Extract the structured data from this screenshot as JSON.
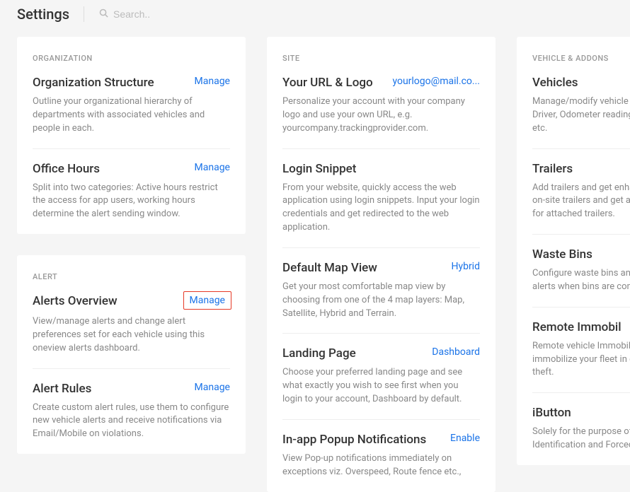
{
  "header": {
    "title": "Settings",
    "search_placeholder": "Search.."
  },
  "columns": [
    {
      "cards": [
        {
          "name": "organization-card",
          "header": "ORGANIZATION",
          "items": [
            {
              "name": "org-structure",
              "title": "Organization Structure",
              "action": "Manage",
              "desc": "Outline your organizational hierarchy of departments with associated vehicles and people in each."
            },
            {
              "name": "office-hours",
              "title": "Office Hours",
              "action": "Manage",
              "desc": "Split into two categories: Active hours restrict the access for app users, working hours determine the alert sending window."
            }
          ]
        },
        {
          "name": "alert-card",
          "header": "ALERT",
          "items": [
            {
              "name": "alerts-overview",
              "title": "Alerts Overview",
              "action": "Manage",
              "highlighted": true,
              "desc": "View/manage alerts and change alert preferences set for each vehicle using this oneview alerts dashboard."
            },
            {
              "name": "alert-rules",
              "title": "Alert Rules",
              "action": "Manage",
              "desc": "Create custom alert rules, use them to configure new vehicle alerts and receive notifications via Email/Mobile on violations."
            }
          ]
        }
      ]
    },
    {
      "cards": [
        {
          "name": "site-card",
          "header": "SITE",
          "items": [
            {
              "name": "url-logo",
              "title": "Your URL & Logo",
              "action": "yourlogo@mail.co...",
              "desc": "Personalize your account with your company logo and use your own URL, e.g. yourcompany.trackingprovider.com."
            },
            {
              "name": "login-snippet",
              "title": "Login Snippet",
              "action": "",
              "desc": "From your website, quickly access the web application using login snippets. Input your login credentials and get redirected to the web application."
            },
            {
              "name": "default-map-view",
              "title": "Default Map View",
              "action": "Hybrid",
              "desc": "Get your most comfortable map view by choosing from one of the 4 map layers: Map, Satellite, Hybrid and Terrain."
            },
            {
              "name": "landing-page",
              "title": "Landing Page",
              "action": "Dashboard",
              "desc": "Choose your preferred landing page and see what exactly you wish to see first when you login to your account, Dashboard by default."
            },
            {
              "name": "popup-notifications",
              "title": "In-app Popup Notifications",
              "action": "Enable",
              "desc": "View Pop-up notifications immediately on exceptions viz. Overspeed, Route fence etc.,"
            }
          ]
        }
      ]
    },
    {
      "cards": [
        {
          "name": "vehicle-addons-card",
          "header": "VEHICLE & ADDONS",
          "items": [
            {
              "name": "vehicles",
              "title": "Vehicles",
              "action": "",
              "desc": "Manage/modify vehicle details: Vehicle Type, Driver, Odometer reading, Driver identification etc."
            },
            {
              "name": "trailers",
              "title": "Trailers",
              "action": "",
              "desc": "Add trailers and get enhanced control over your on-site trailers and get a visual representation for attached trailers."
            },
            {
              "name": "waste-bins",
              "title": "Waste Bins",
              "action": "",
              "desc": "Configure waste bins and receive automated alerts when bins are connected/disconnected."
            },
            {
              "name": "remote-immobilizer",
              "title": "Remote Immobil",
              "action": "",
              "desc": "Remote vehicle Immobilization allows you to immobilize your fleet in case of abnormal use or theft."
            },
            {
              "name": "ibutton",
              "title": "iButton",
              "action": "",
              "desc": "Solely for the purpose of driver ID, two modes: Identification and Forced Entry."
            }
          ]
        }
      ]
    }
  ]
}
